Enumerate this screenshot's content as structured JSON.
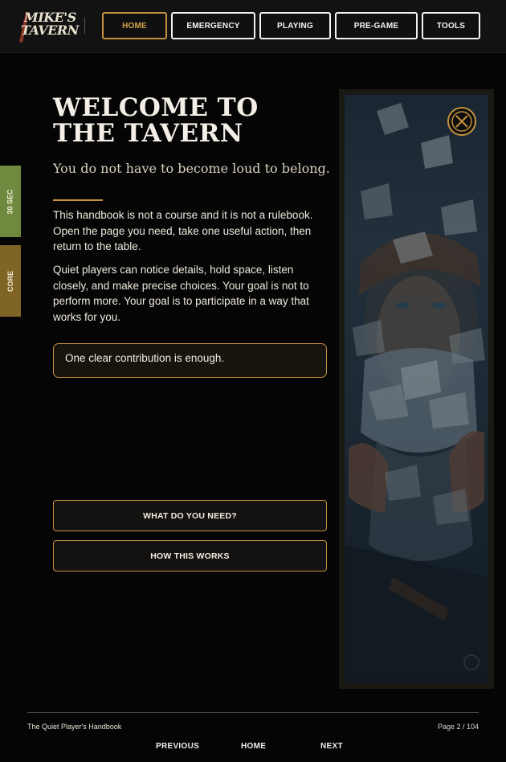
{
  "brand": {
    "logo_line1": "MIKE'S",
    "logo_line2": "TAVERN"
  },
  "nav": {
    "home": "HOME",
    "emergency": "EMERGENCY",
    "playing": "PLAYING",
    "pregame": "PRE-GAME",
    "tools": "TOOLS",
    "active": "HOME"
  },
  "side_tabs": {
    "quick": {
      "label": "30 SEC",
      "color": "#6f8a3e"
    },
    "core": {
      "label": "CORE",
      "color": "#7f6426"
    }
  },
  "main": {
    "title": "WELCOME TO THE TAVERN",
    "subtitle": "You do not have to become loud to belong.",
    "paragraph1": "This handbook is not a course and it is not a rulebook. Open the page you need, take one useful action, then return to the table.",
    "paragraph2": "Quiet players can notice details, hold space, listen closely, and make precise choices. Your goal is not to perform more. Your goal is to participate in a way that works for you.",
    "callout": "One clear contribution is enough.",
    "buttons": {
      "need": "WHAT DO YOU NEED?",
      "how": "HOW THIS WORKS"
    }
  },
  "artwork": {
    "close_icon": "close-icon"
  },
  "footer": {
    "handbook_title": "The Quiet Player's Handbook",
    "page_label": "Page 2 / 104",
    "previous": "PREVIOUS",
    "home": "HOME",
    "next": "NEXT"
  },
  "colors": {
    "accent": "#c4913f",
    "background": "#050505",
    "text": "#ece6da"
  }
}
